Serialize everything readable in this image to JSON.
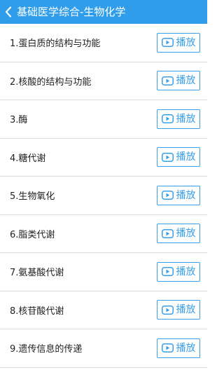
{
  "colors": {
    "header_bg": "#2f9de9",
    "accent": "#3a9fe6",
    "divider": "#dcdcdc"
  },
  "header": {
    "back_icon": "chevron-left-icon",
    "title": "基础医学综合-生物化学"
  },
  "play_icon": "play-icon",
  "items": [
    {
      "label": "1.蛋白质的结构与功能",
      "action": "播放"
    },
    {
      "label": "2.核酸的结构与功能",
      "action": "播放"
    },
    {
      "label": "3.酶",
      "action": "播放"
    },
    {
      "label": "4.糖代谢",
      "action": "播放"
    },
    {
      "label": "5.生物氧化",
      "action": "播放"
    },
    {
      "label": "6.脂类代谢",
      "action": "播放"
    },
    {
      "label": "7.氨基酸代谢",
      "action": "播放"
    },
    {
      "label": "8.核苷酸代谢",
      "action": "播放"
    },
    {
      "label": "9.遗传信息的传递",
      "action": "播放"
    }
  ]
}
